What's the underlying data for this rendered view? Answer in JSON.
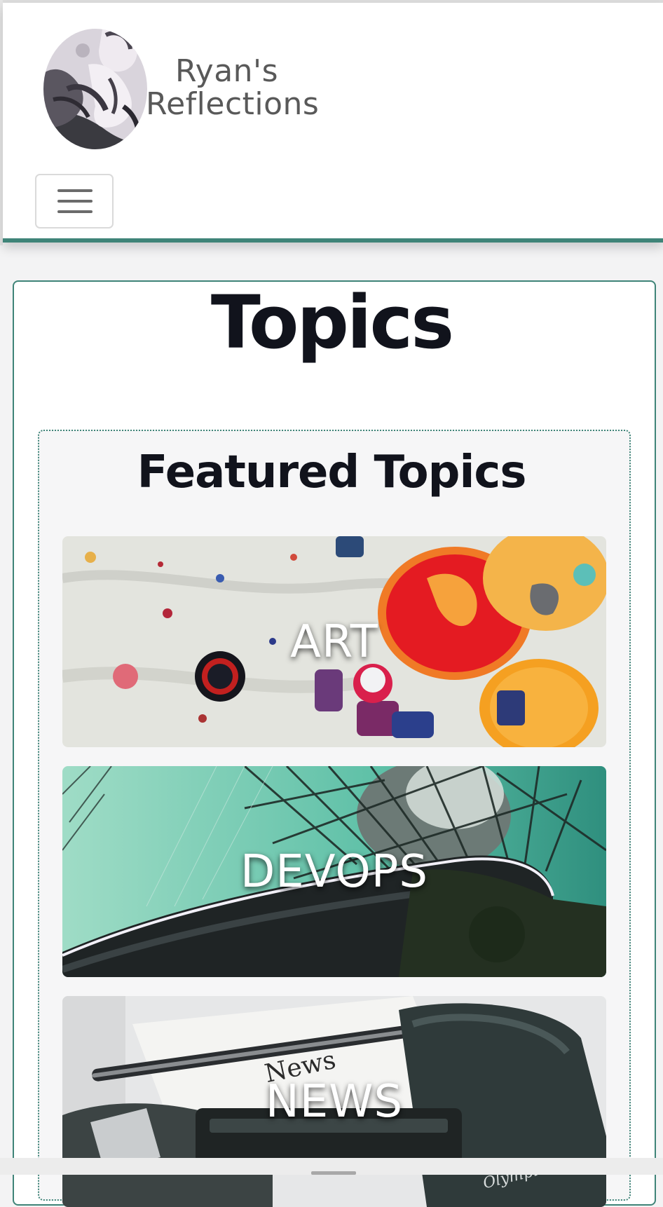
{
  "header": {
    "brand_line1": "Ryan's",
    "brand_line2": "Reflections",
    "logo_icon": "thinker-statue-icon",
    "menu_icon": "hamburger-menu-icon"
  },
  "main": {
    "title": "Topics",
    "featured": {
      "title": "Featured Topics",
      "topics": [
        {
          "label": "ART",
          "image": "paint-splatter-palette-image"
        },
        {
          "label": "DEVOPS",
          "image": "bridge-supertree-image"
        },
        {
          "label": "NEWS",
          "image": "typewriter-news-image"
        }
      ]
    }
  },
  "colors": {
    "accent": "#3f8478",
    "title": "#11131c",
    "brand_text": "#595959",
    "page_bg": "#f3f3f4"
  }
}
